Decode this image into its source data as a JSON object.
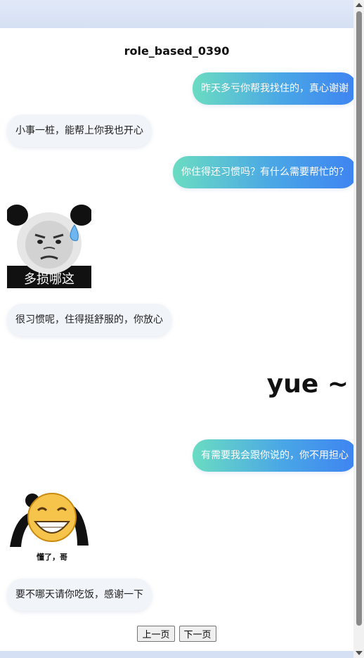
{
  "chat": {
    "title": "role_based_0390",
    "messages": [
      {
        "side": "right",
        "type": "text",
        "text": "昨天多亏你帮我找住的，真心谢谢"
      },
      {
        "side": "left",
        "type": "text",
        "text": "小事一桩，能帮上你我也开心"
      },
      {
        "side": "right",
        "type": "text",
        "text": "你住得还习惯吗？有什么需要帮忙的？"
      },
      {
        "side": "left",
        "type": "sticker",
        "caption": "多损哪这"
      },
      {
        "side": "left",
        "type": "text",
        "text": "很习惯呢，住得挺舒服的，你放心"
      },
      {
        "side": "right",
        "type": "sticker",
        "caption": "yue ~"
      },
      {
        "side": "right",
        "type": "text",
        "text": "有需要我会跟你说的，你不用担心"
      },
      {
        "side": "left",
        "type": "sticker",
        "caption": "懂了，哥"
      },
      {
        "side": "left",
        "type": "text",
        "text": "要不哪天请你吃饭，感谢一下"
      }
    ]
  },
  "pager": {
    "prev_label": "上一页",
    "next_label": "下一页"
  },
  "colors": {
    "bubble_gradient_start": "#6adcc2",
    "bubble_gradient_end": "#3e83f2",
    "left_bubble": "#f1f4f9"
  }
}
